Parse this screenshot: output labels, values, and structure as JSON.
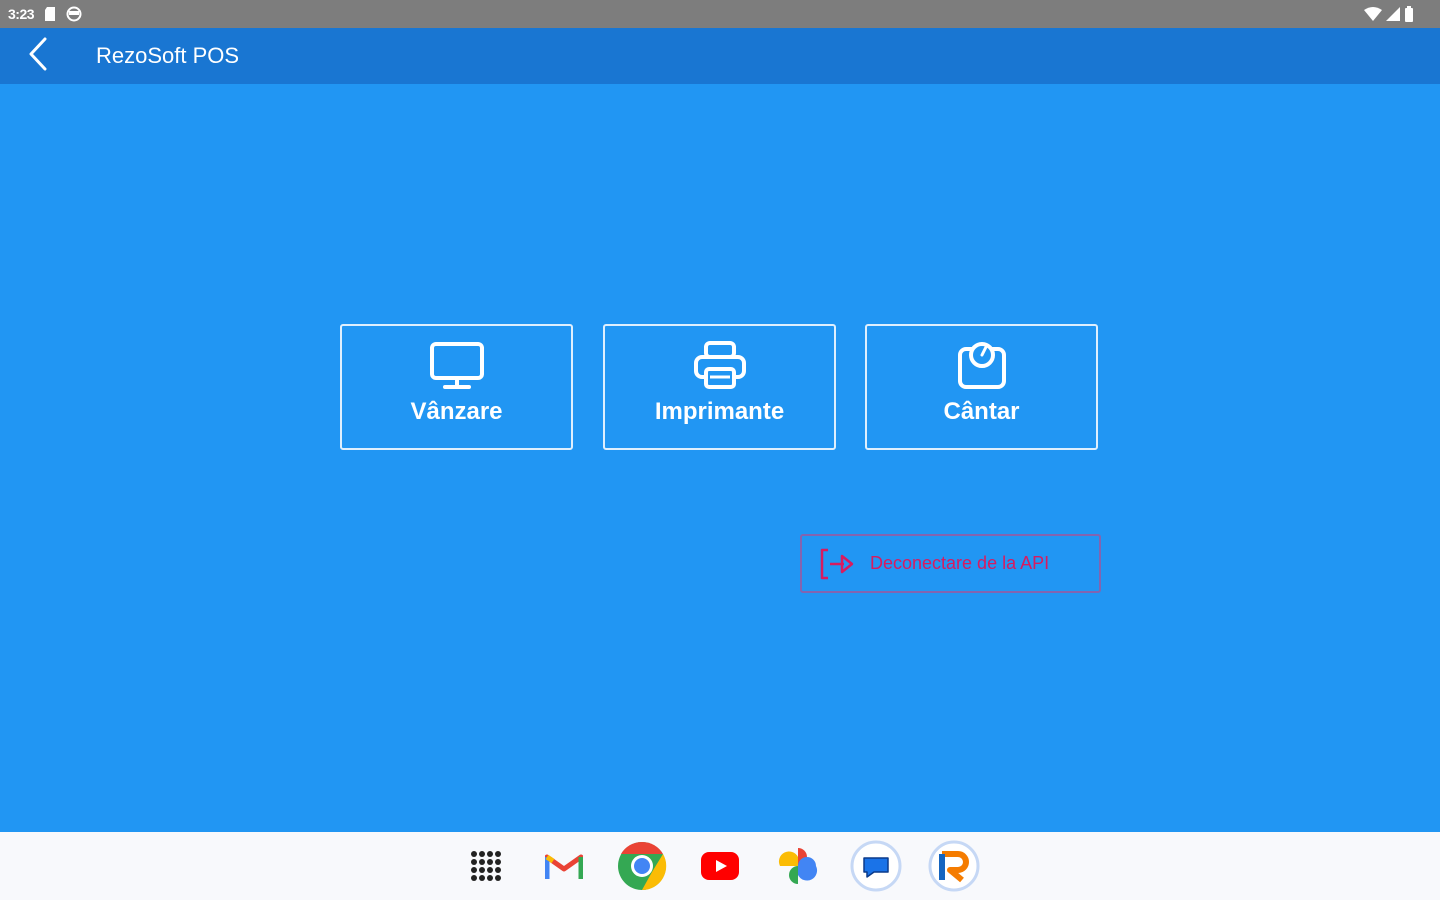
{
  "status_bar": {
    "time": "3:23",
    "left_icons": [
      "sd-card-icon",
      "sync-icon"
    ],
    "right_icons": [
      "wifi-icon",
      "cell-signal-icon",
      "battery-icon"
    ]
  },
  "app_bar": {
    "back_icon": "back-arrow-icon",
    "title": "RezoSoft POS"
  },
  "tiles": [
    {
      "label": "Vânzare",
      "icon": "monitor-icon"
    },
    {
      "label": "Imprimante",
      "icon": "printer-icon"
    },
    {
      "label": "Cântar",
      "icon": "scale-icon"
    }
  ],
  "disconnect": {
    "label": "Deconectare de la API",
    "icon": "logout-icon"
  },
  "colors": {
    "background": "#2196F3",
    "app_bar": "#1976D2",
    "status_bar": "#7d7d7d",
    "taskbar": "#f8f9fc",
    "disconnect_text": "#D81B60"
  },
  "taskbar": {
    "apps": [
      "app-drawer-icon",
      "gmail-icon",
      "chrome-icon",
      "youtube-icon",
      "photos-icon",
      "messages-icon",
      "rezosoft-icon"
    ]
  }
}
